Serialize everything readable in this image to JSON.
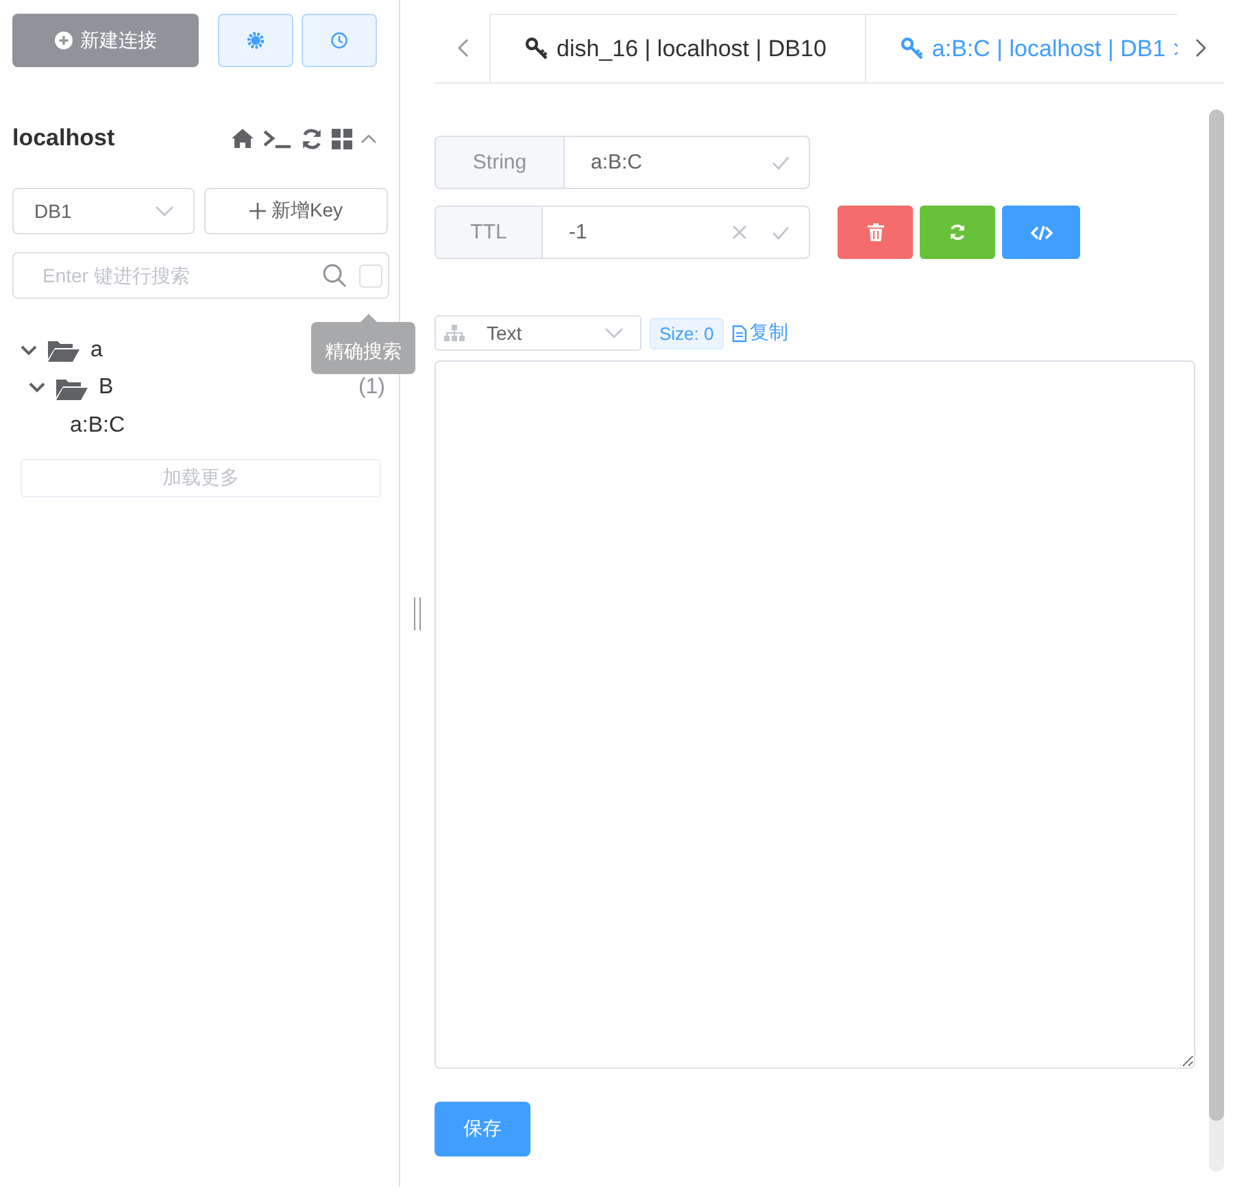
{
  "sidebar": {
    "new_connection_button": "新建连接",
    "connection": {
      "name": "localhost",
      "expanded": true
    },
    "db_select": "DB1",
    "add_key_button": "新增Key",
    "search": {
      "placeholder": "Enter 键进行搜索",
      "exact_checked": false,
      "tooltip": "精确搜索"
    },
    "tree": [
      {
        "label": "a",
        "expanded": true,
        "children": [
          {
            "label": "B",
            "count": "(1)",
            "expanded": true,
            "children": [
              {
                "label": "a:B:C"
              }
            ]
          }
        ]
      }
    ],
    "load_more_button": {
      "label": "加载更多",
      "disabled": true
    }
  },
  "tabs": [
    {
      "label": "dish_16 | localhost | DB10",
      "selected": false
    },
    {
      "label": "a:B:C | localhost | DB1",
      "selected": true
    }
  ],
  "key": {
    "type": "String",
    "name": "a:B:C",
    "ttl_label": "TTL",
    "ttl": "-1"
  },
  "value": {
    "format": "Text",
    "size": "Size: 0",
    "copy": "复制"
  },
  "save_button": "保存"
}
